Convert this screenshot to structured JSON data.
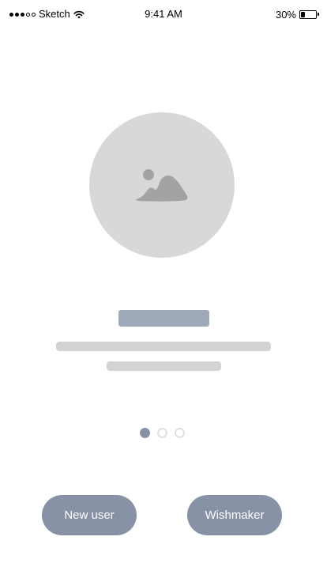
{
  "status_bar": {
    "carrier": "Sketch",
    "time": "9:41 AM",
    "battery": "30%",
    "signal_bars_filled": 3,
    "signal_bars_total": 5,
    "battery_level": 0.3,
    "icons": [
      "signal-icon",
      "wifi-icon",
      "battery-icon"
    ]
  },
  "onboarding": {
    "illustration_icon": "image-placeholder-icon",
    "pagination": {
      "total": 3,
      "active_index": 0
    }
  },
  "actions": {
    "new_user_label": "New user",
    "wishmaker_label": "Wishmaker"
  },
  "colors": {
    "accent": "#8792a6",
    "title_placeholder": "#a0a9b8",
    "text_placeholder": "#d3d3d3",
    "illustration_bg": "#d8d8d8",
    "icon_fill": "#a3a3a3",
    "inactive_dot_border": "#dde1e7"
  }
}
